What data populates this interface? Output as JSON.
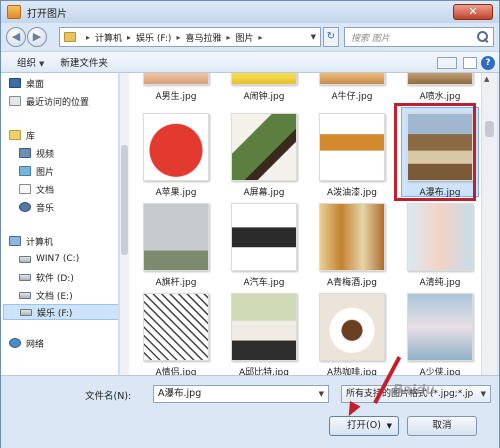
{
  "window": {
    "title": "打开图片",
    "close_glyph": "✕"
  },
  "navbar": {
    "back_glyph": "◀",
    "forward_glyph": "▶",
    "breadcrumbs": [
      "计算机",
      "娱乐 (F:)",
      "喜马拉雅",
      "图片"
    ],
    "search_placeholder": "搜索 图片",
    "refresh_glyph": "↻"
  },
  "toolbar": {
    "organize_label": "组织",
    "new_folder_label": "新建文件夹",
    "help_glyph": "?"
  },
  "sidebar": {
    "items": [
      {
        "label": "桌面",
        "icon": "desktop-icon"
      },
      {
        "label": "最近访问的位置",
        "icon": "recent-places-icon"
      },
      {
        "label": "库",
        "icon": "library-icon"
      },
      {
        "label": "视频",
        "icon": "video-library-icon"
      },
      {
        "label": "图片",
        "icon": "picture-library-icon"
      },
      {
        "label": "文档",
        "icon": "document-library-icon"
      },
      {
        "label": "音乐",
        "icon": "music-library-icon"
      },
      {
        "label": "计算机",
        "icon": "computer-icon"
      },
      {
        "label": "WIN7 (C:)",
        "icon": "drive-icon"
      },
      {
        "label": "软件 (D:)",
        "icon": "drive-icon"
      },
      {
        "label": "文档 (E:)",
        "icon": "drive-icon"
      },
      {
        "label": "娱乐 (F:)",
        "icon": "drive-icon",
        "selected": true
      },
      {
        "label": "网络",
        "icon": "network-icon"
      }
    ]
  },
  "files": {
    "row0": [
      "A男生.jpg",
      "A闹钟.jpg",
      "A牛仔.jpg",
      "A喷水.jpg"
    ],
    "row1": [
      "A苹果.jpg",
      "A屏幕.jpg",
      "A泼油漆.jpg",
      "A瀑布.jpg"
    ],
    "row2": [
      "A旗杆.jpg",
      "A汽车.jpg",
      "A青梅酒.jpg",
      "A清纯.jpg"
    ],
    "row3": [
      "A情侣.jpg",
      "A邱比特.jpg",
      "A热咖啡.jpg",
      "A少侠.jpg"
    ],
    "selected": "A瀑布.jpg"
  },
  "bottom": {
    "filename_label": "文件名(N):",
    "filename_value": "A瀑布.jpg",
    "filter_value": "所有支持的图片格式 (*.jpg;*.jp",
    "open_label": "打开(O)",
    "cancel_label": "取消"
  },
  "colors": {
    "highlight": "#c31e2c",
    "selection": "#cde3f9"
  },
  "watermark": "Baidu"
}
